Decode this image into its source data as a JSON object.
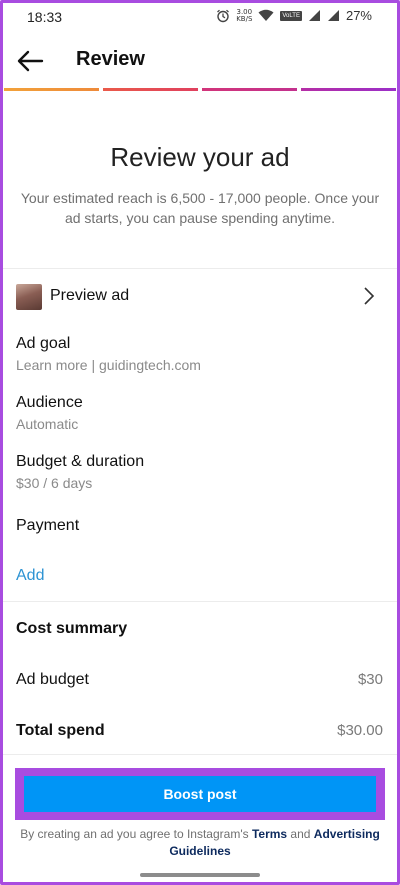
{
  "status_bar": {
    "time": "18:33",
    "speed_top": "3.00",
    "speed_bottom": "KB/S",
    "volte": "VoLTE",
    "battery": "27%"
  },
  "header": {
    "title": "Review",
    "progress_colors": [
      "#f5a623",
      "#e8415a",
      "#c13584",
      "#9b2fc8"
    ]
  },
  "main": {
    "title": "Review your ad",
    "subtitle": "Your estimated reach is 6,500 - 17,000 people. Once your ad starts, you can pause spending anytime."
  },
  "rows": {
    "preview": "Preview ad",
    "ad_goal_label": "Ad goal",
    "ad_goal_value": "Learn more | guidingtech.com",
    "audience_label": "Audience",
    "audience_value": "Automatic",
    "budget_label": "Budget & duration",
    "budget_value": "$30 / 6 days",
    "payment_label": "Payment",
    "add_label": "Add"
  },
  "cost": {
    "title": "Cost summary",
    "ad_budget_label": "Ad budget",
    "ad_budget_value": "$30",
    "total_label": "Total spend",
    "total_value": "$30.00"
  },
  "footer": {
    "boost_label": "Boost post",
    "terms_prefix": "By creating an ad you agree to Instagram's ",
    "terms_link": "Terms",
    "terms_and": " and ",
    "guidelines_link": "Advertising Guidelines"
  },
  "colors": {
    "accent": "#0095f6",
    "highlight": "#a84ce0",
    "link": "#2d93d3"
  }
}
